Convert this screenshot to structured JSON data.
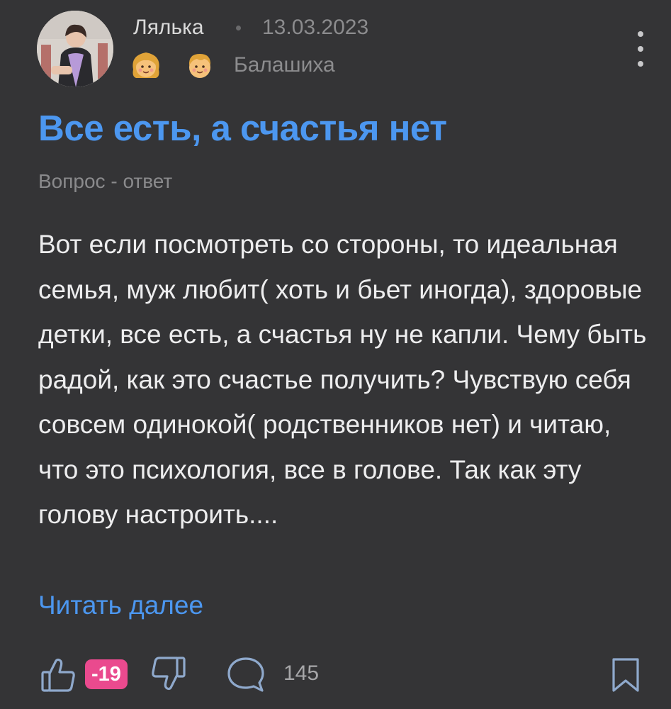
{
  "header": {
    "author": "Лялька",
    "date": "13.03.2023",
    "city": "Балашиха",
    "badges": [
      "girl-face-icon",
      "boy-face-icon"
    ]
  },
  "post": {
    "title": "Все есть, а счастья нет",
    "category": "Вопрос - ответ",
    "body": "Вот если посмотреть со стороны, то идеальная семья, муж любит( хоть и бьет иногда), здоровые детки, все есть, а счастья ну не капли. Чему быть радой, как это счастье получить? Чувствую себя совсем одинокой( родственников нет) и читаю, что это психология, все в голове. Так как эту голову настроить....",
    "read_more": "Читать далее"
  },
  "footer": {
    "score": "-19",
    "comments": "145"
  },
  "colors": {
    "background": "#343436",
    "accent": "#4c97f0",
    "score_badge": "#ea4a8e",
    "icon": "#8fa9cc"
  }
}
